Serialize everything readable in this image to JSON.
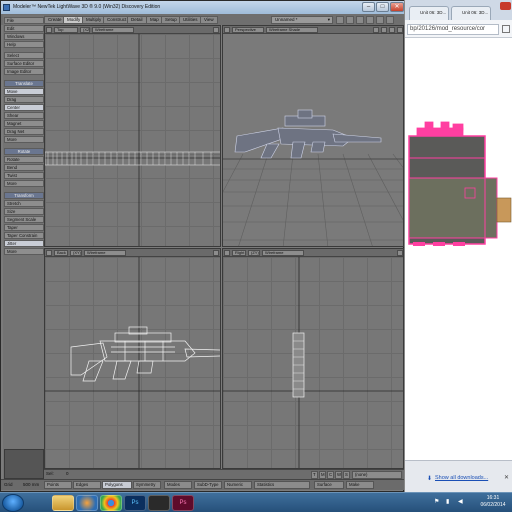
{
  "modeler": {
    "title": "Modeler™ NewTek LightWave 3D ® 9.0 (Win32) Discovery Edition",
    "window_controls": {
      "minimize": "–",
      "maximize": "□",
      "close": "✕"
    },
    "tabs": [
      "Create",
      "Modify",
      "Multiply",
      "Construct",
      "Detail",
      "Map",
      "Setup",
      "Utilities",
      "View"
    ],
    "active_tab": "Modify",
    "layer_dropdown": "Unnamed *",
    "sidebar": {
      "top_items": [
        "File",
        "Edit",
        "Windows",
        "Help",
        "Select",
        "Surface Editor",
        "Image Editor"
      ],
      "translate_header": "Translate",
      "translate_items": [
        "Move",
        "Drag",
        "Center",
        "Shear",
        "Magnet",
        "Drag Net",
        "More"
      ],
      "rotate_header": "Rotate",
      "rotate_items": [
        "Rotate",
        "Bend",
        "Twist",
        "More"
      ],
      "transform_header": "Transform",
      "transform_items": [
        "Stretch",
        "Size",
        "Segment Scale",
        "Taper",
        "Taper Constrain",
        "Jitter",
        "More"
      ]
    },
    "viewports": {
      "top": {
        "view": "Top",
        "axes": "(XZ)",
        "mode": "Wireframe"
      },
      "perspective": {
        "view": "Perspective",
        "mode": "Wireframe Shade"
      },
      "back": {
        "view": "Back",
        "axes": "(XY)",
        "mode": "Wireframe"
      },
      "right": {
        "view": "Right",
        "axes": "(ZY)",
        "mode": "Wireframe"
      }
    },
    "slider_bar": {
      "label": "Sel:",
      "value": "0",
      "buttons": [
        "T",
        "M",
        "C",
        "W",
        "S"
      ],
      "surface": "(none)"
    },
    "status_bar": {
      "grid_label": "Grid",
      "grid_value": "500 mm",
      "items": [
        "Points",
        "Edges",
        "Polygons",
        "Symmetry",
        "Modes",
        "SubD-Type",
        "Numeric",
        "Statistics",
        "Surface",
        "Make"
      ]
    }
  },
  "browser": {
    "tabs": [
      "Unit 06: 3D...",
      "Unit 06: 3D..."
    ],
    "url": "bp/20126/mod_resource/cor",
    "download_text": "Show all downloads..."
  },
  "taskbar": {
    "time": "16:31",
    "date": "06/02/2014",
    "app_icons": [
      "explorer-icon",
      "media-player-icon",
      "chrome-icon",
      "photoshop-icon",
      "lightwave-icon",
      "photoshop-icon"
    ]
  }
}
